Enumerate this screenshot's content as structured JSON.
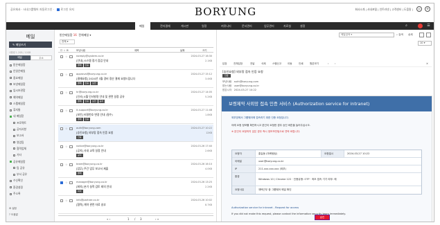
{
  "topbar": {
    "crumb": "공유회사 · 사내그룹웨어 자동로그인 ·",
    "check_label": "로그인 유지",
    "logo": "BORYUNG",
    "links": "회사소개 | 사내포털 | 인트라넷 | 고객센터 | 도움말 |",
    "icon_user": "user-icon",
    "icon_settings": "gear-icon"
  },
  "nav": {
    "items": [
      "메일",
      "전자결재",
      "게시판",
      "일정",
      "커뮤니티",
      "문서관리",
      "업무관리",
      "자료실",
      "설정"
    ],
    "active": "메일"
  },
  "sidebar": {
    "title": "메일",
    "write": "메일쓰기",
    "quota": "사용량 1.2GB / 10GB",
    "tab_mail": "메일",
    "tab_addr": "주소",
    "folders": [
      {
        "label": "받은메일함",
        "type": "normal"
      },
      {
        "label": "안읽은메일",
        "type": "normal"
      },
      {
        "label": "중요메일",
        "type": "normal"
      },
      {
        "label": "보낸메일함",
        "type": "normal"
      },
      {
        "label": "임시보관함",
        "type": "normal"
      },
      {
        "label": "예약메일",
        "type": "normal"
      },
      {
        "label": "스팸메일함",
        "type": "normal"
      },
      {
        "label": "휴지통",
        "type": "normal"
      },
      {
        "label": "내 메일함",
        "type": "section"
      },
      {
        "label": "프로젝트",
        "type": "sub"
      },
      {
        "label": "공지사항",
        "type": "sub"
      },
      {
        "label": "보고서",
        "type": "sub"
      },
      {
        "label": "영업팀",
        "type": "sub"
      },
      {
        "label": "협력업체",
        "type": "sub"
      },
      {
        "label": "기타",
        "type": "sub"
      },
      {
        "label": "공유메일함",
        "type": "section"
      },
      {
        "label": "팀 공유",
        "type": "sub"
      },
      {
        "label": "부서 공유",
        "type": "sub"
      },
      {
        "label": "수신확인",
        "type": "normal"
      },
      {
        "label": "환경설정",
        "type": "normal"
      },
      {
        "label": "주소록",
        "type": "normal"
      }
    ],
    "bottom_items": [
      "설정",
      "도움말"
    ]
  },
  "list": {
    "heading": "받은메일함",
    "unread_count": "16",
    "heading_extra": "전체메일 ▾",
    "filter": "전체 ▾",
    "columns": [
      "보낸사람",
      "제목",
      "날짜",
      "크기"
    ],
    "rows": [
      {
        "from": "noreply@system.co.kr",
        "subject": "[안내] 시스템 정기 점검 안내",
        "tags": [
          "결재",
          "인증"
        ],
        "date": "2024-03-27 16:30",
        "size": "2.1KB",
        "checked": false,
        "selected": false
      },
      {
        "from": "approval@boryung.co.kr",
        "subject": "[결재요청] 2024년 3월 경비 정산 결재 요청드립니다",
        "tags": [
          "결재",
          "인증",
          "보안"
        ],
        "date": "2024-03-27 15:12",
        "size": "3.4KB",
        "checked": false,
        "selected": false
      },
      {
        "from": "hr@boryung.co.kr",
        "subject": "[인사] 4월 인사발령 안내 및 관련 일정 공유",
        "tags": [
          "결재",
          "인증",
          "보안",
          "공지"
        ],
        "date": "2024-03-27 14:05",
        "size": "5.2KB",
        "checked": false,
        "selected": false
      },
      {
        "from": "it-support@boryung.co.kr",
        "subject": "[보안] 비밀번호 변경 안내 (필수)",
        "tags": [
          "결재",
          "인증"
        ],
        "date": "2024-03-27 11:48",
        "size": "1.8KB",
        "checked": false,
        "selected": false
      },
      {
        "from": "auth@boryung.com",
        "subject": "[승인요청] 외부망 접속 인증 요청",
        "tags": [
          "인증"
        ],
        "date": "2024-03-27 10:22",
        "size": "12KB",
        "checked": false,
        "selected": true
      },
      {
        "from": "notice@boryung.co.kr",
        "subject": "[공지] 사내 교육 일정 안내",
        "tags": [
          "공지"
        ],
        "date": "2024-03-26 17:40",
        "size": "2.6KB",
        "checked": false,
        "selected": false
      },
      {
        "from": "team@boryung.co.kr",
        "subject": "[업무] 주간 업무 보고서 제출",
        "tags": [
          "결재"
        ],
        "date": "2024-03-26 16:10",
        "size": "4.0KB",
        "checked": false,
        "selected": false
      },
      {
        "from": "manager@boryung.co.kr",
        "subject": "[회의] 분기 실적 검토 회의 안내",
        "tags": [
          "회의"
        ],
        "date": "2024-03-26 13:25",
        "size": "2.2KB",
        "checked": true,
        "selected": false
      },
      {
        "from": "info@partner.co.kr",
        "subject": "[협력] 계약 관련 자료 송부",
        "tags": [],
        "date": "2024-03-26 10:02",
        "size": "8.7KB",
        "checked": false,
        "selected": false
      }
    ],
    "pager": {
      "prev": "«  ‹",
      "current": "1",
      "sep": "/",
      "total": "3",
      "next": "›  »"
    }
  },
  "reader": {
    "search_placeholder": "메일검색 ▾",
    "search_btn": "검색",
    "detail_btn": "상세",
    "page_select": "10 ▾",
    "toolbar": [
      "답장",
      "전체답장",
      "전달",
      "삭제",
      "스팸신고",
      "이동",
      "인쇄",
      "원본보기",
      "‹",
      "›"
    ],
    "subject": "[승인요청] 외부망 접속 인증 요청",
    "subject_tag": "인증",
    "from_label": "보낸사람",
    "from_value": "auth@boryung.com",
    "to_label": "받는사람",
    "to_value": "user@boryung.co.kr",
    "date_label": "받은시각",
    "date_value": "2024-03-27 10:22",
    "banner": "보령제약 사외망 접속 인증 서비스 (Authorization service for intranet)",
    "intro": "외부망에서 그룹웨어에 접속하기 위한 인증 요청입니다.",
    "desc": "아래 요청 정보를 확인하시고 본인이 요청한 경우 승인 버튼을 눌러주십시오.",
    "warning": "※ 본인이 요청하지 않은 경우 즉시 정보보안팀으로 연락 바랍니다.",
    "table": [
      {
        "k": "요청자",
        "v": "홍길동 (마케팅팀)",
        "k2": "요청일시",
        "v2": "2024-03-27 10:22"
      },
      {
        "k": "이메일",
        "v": "user@boryung.co.kr",
        "k2": "",
        "v2": ""
      },
      {
        "k": "IP",
        "v": "211.xxx.xxx.xxx (외부)",
        "k2": "",
        "v2": ""
      },
      {
        "k": "환경",
        "v": "Windows 10 / Chrome 122 · 인증유형: OTP · 최초 접속 기기 여부: 예",
        "k2": "",
        "v2": ""
      },
      {
        "k": "요청사유",
        "v": "재택근무 중 그룹웨어 메일 확인",
        "k2": "",
        "v2": ""
      }
    ],
    "approve": "승인",
    "footer_link": "Authorization service for intranet - Request for access",
    "footer_text": "If you did not make this request, please contact the information security team immediately."
  }
}
